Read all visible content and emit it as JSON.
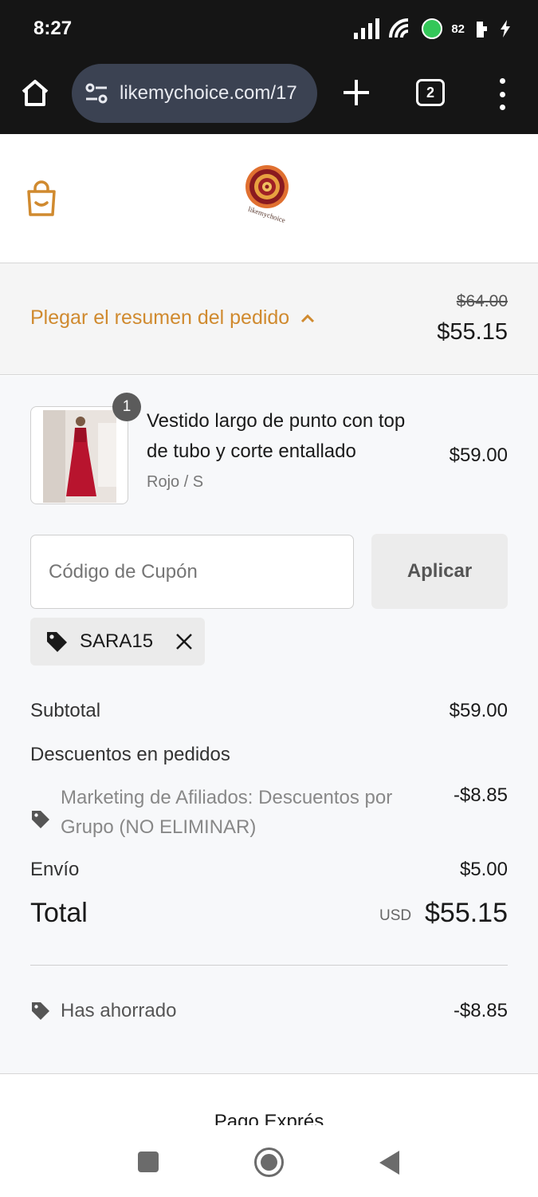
{
  "status_bar": {
    "time": "8:27",
    "battery": "82"
  },
  "browser": {
    "url": "likemychoice.com/17",
    "tab_count": "2"
  },
  "store": {
    "logo_text": "likemychoice"
  },
  "summary": {
    "toggle_label": "Plegar el resumen del pedido",
    "original_total": "$64.00",
    "total": "$55.15"
  },
  "product": {
    "quantity": "1",
    "name": "Vestido largo de punto con top de tubo y corte entallado",
    "variant": "Rojo / S",
    "price": "$59.00"
  },
  "coupon": {
    "placeholder": "Código de Cupón",
    "apply_label": "Aplicar",
    "applied_code": "SARA15"
  },
  "totals": {
    "subtotal_label": "Subtotal",
    "subtotal_value": "$59.00",
    "discounts_label": "Descuentos en pedidos",
    "affiliate_label": "Marketing de Afiliados: Descuentos por Grupo (NO ELIMINAR)",
    "affiliate_value": "-$8.85",
    "shipping_label": "Envío",
    "shipping_value": "$5.00",
    "total_label": "Total",
    "currency": "USD",
    "total_value": "$55.15",
    "saved_label": "Has ahorrado",
    "saved_value": "-$8.85"
  },
  "express_checkout": "Pago Exprés",
  "colors": {
    "accent": "#d08a2f",
    "chrome": "#151515",
    "panel": "#f7f8fa"
  }
}
